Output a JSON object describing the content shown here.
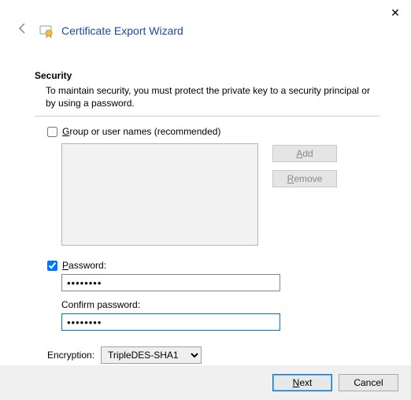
{
  "window": {
    "close_glyph": "✕",
    "title": "Certificate Export Wizard"
  },
  "security": {
    "heading": "Security",
    "description": "To maintain security, you must protect the private key to a security principal or by using a password.",
    "group_check": {
      "checked": false,
      "prefix": "G",
      "rest": "roup or user names (recommended)"
    },
    "buttons": {
      "add": {
        "prefix": "A",
        "rest": "dd"
      },
      "remove": {
        "prefix": "R",
        "rest": "emove"
      }
    },
    "password_check": {
      "checked": true,
      "prefix": "P",
      "rest": "assword:"
    },
    "password_value": "••••••••",
    "confirm_label": "Confirm password:",
    "confirm_value": "••••••••",
    "encryption_label": "Encryption:",
    "encryption_value": "TripleDES-SHA1"
  },
  "footer": {
    "next": {
      "prefix": "N",
      "rest": "ext"
    },
    "cancel": "Cancel"
  }
}
